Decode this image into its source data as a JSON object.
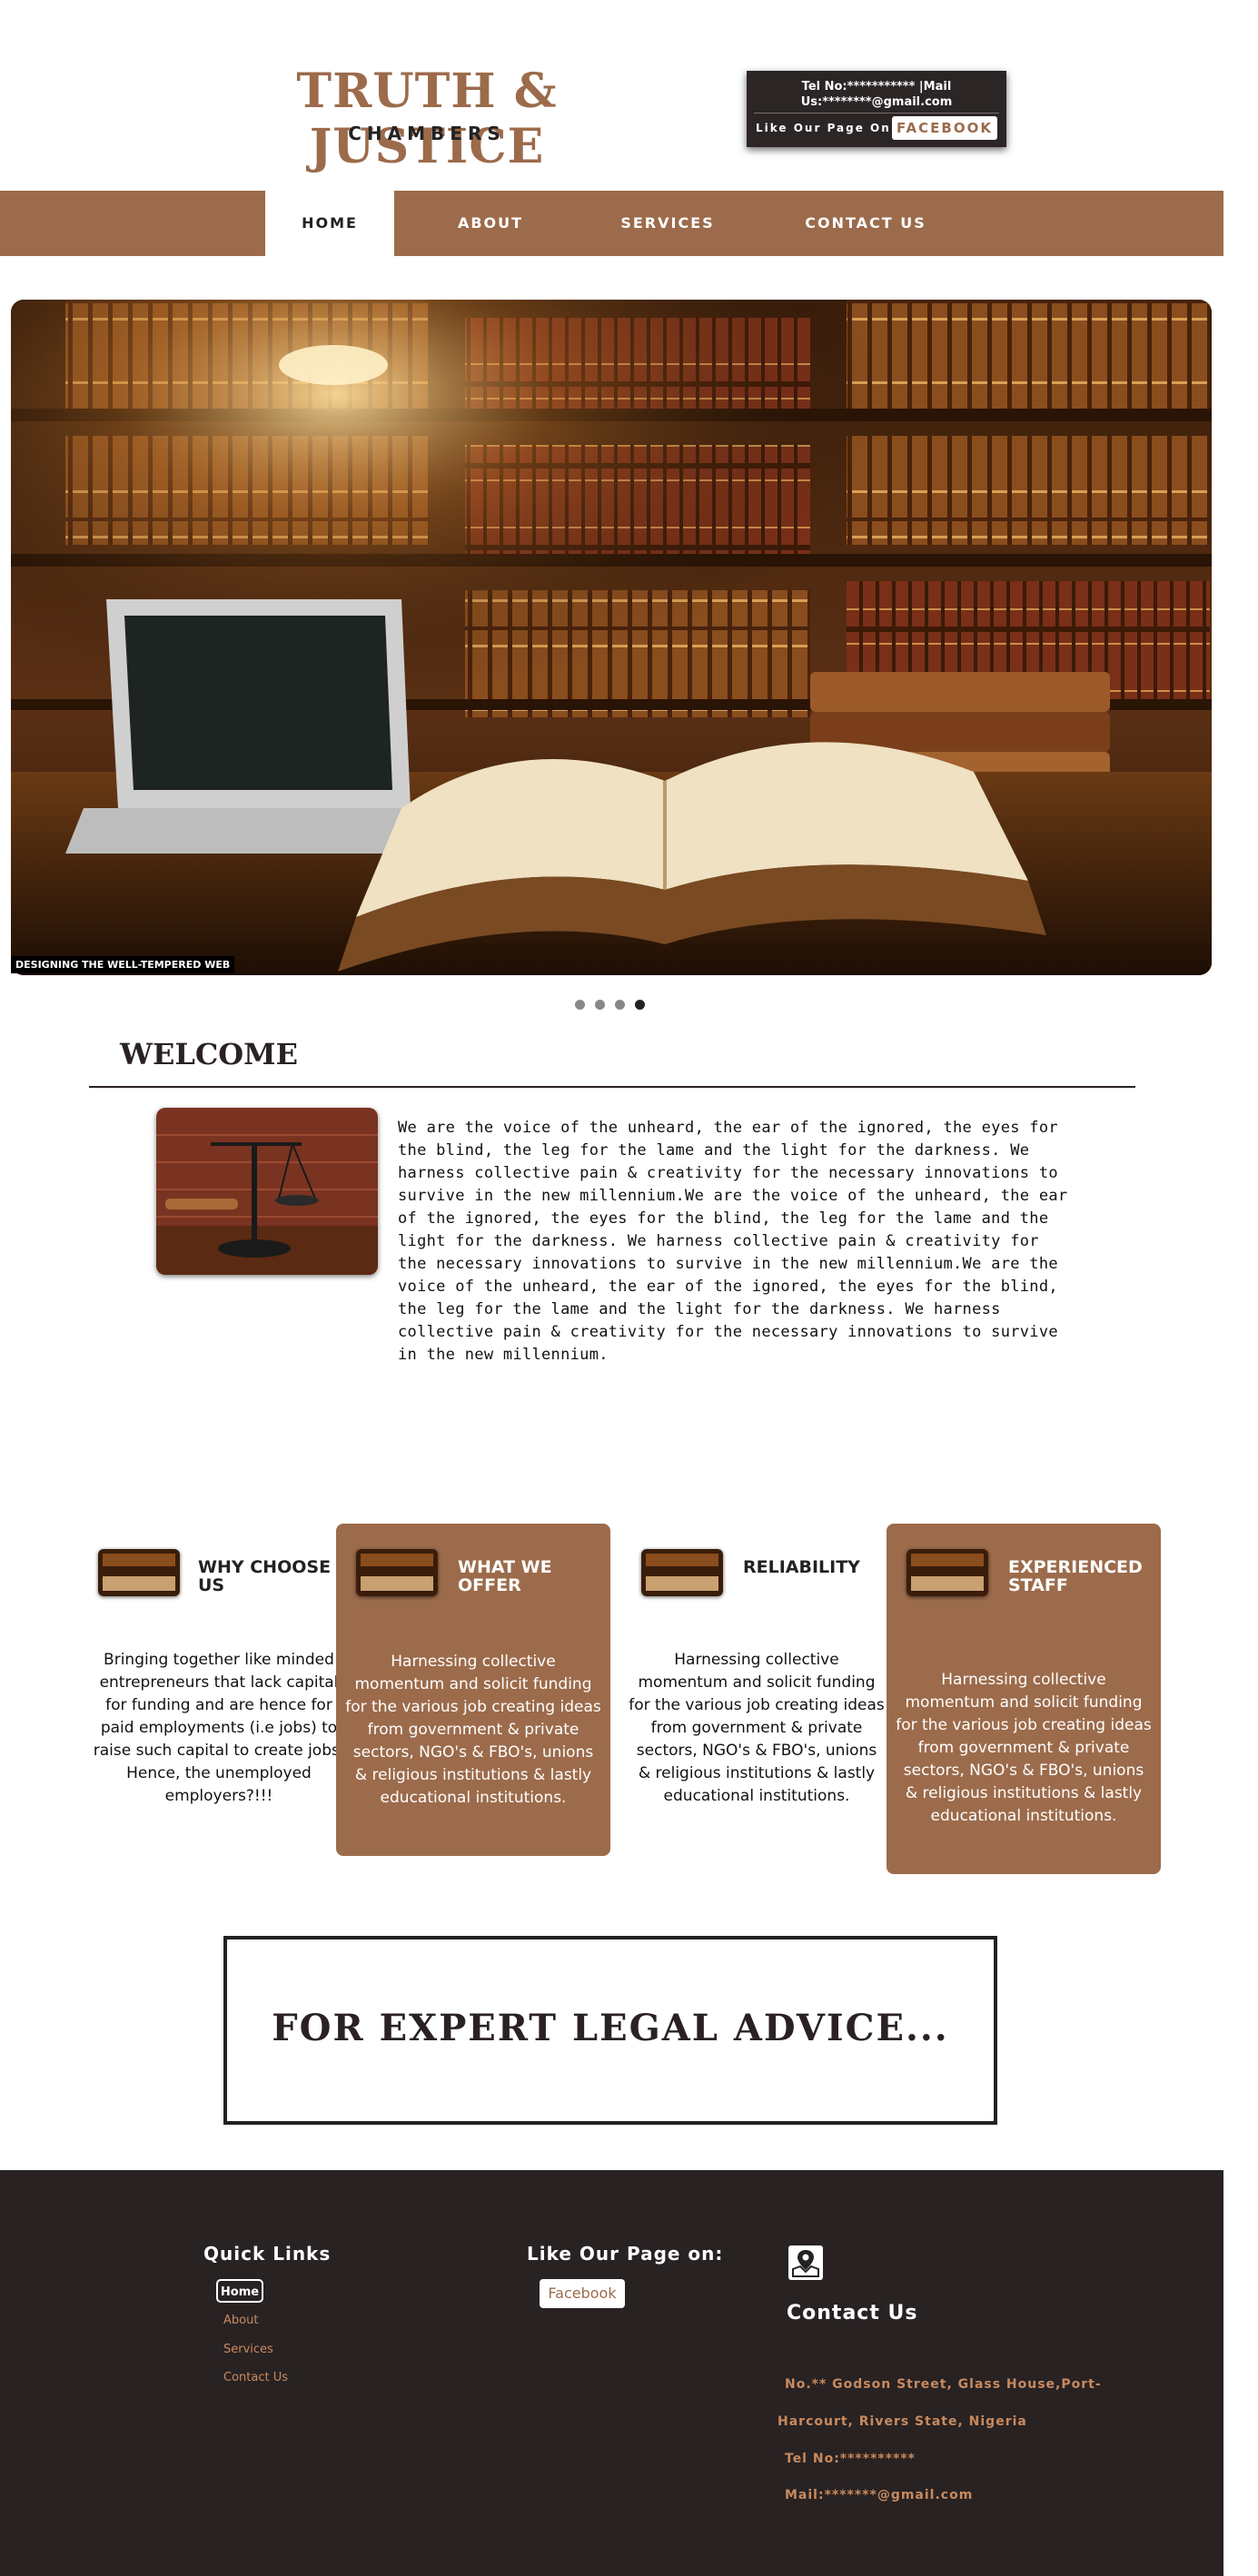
{
  "header": {
    "logo_title": "TRUTH & JUSTICE",
    "logo_subtitle": "CHAMBERS",
    "contact_tel": "Tel No:*********** |Mail",
    "contact_mail": "Us:********@gmail.com",
    "like_label": "Like Our Page On:",
    "facebook_label": "FACEBOOK"
  },
  "nav": {
    "items": [
      {
        "label": "HOME",
        "active": true
      },
      {
        "label": "ABOUT"
      },
      {
        "label": "SERVICES"
      },
      {
        "label": "CONTACT US"
      }
    ]
  },
  "slider": {
    "caption": "DESIGNING THE WELL-TEMPERED WEB",
    "slide_count": 4,
    "active_slide": 4
  },
  "welcome": {
    "title": "WELCOME",
    "text": "We are the voice of the unheard, the ear of the ignored, the eyes for the blind, the leg for the lame and the light for the darkness. We harness collective pain & creativity for the necessary innovations to survive in the new millennium.We are the voice of the unheard, the ear of the ignored, the eyes for the blind, the leg for the lame and the light for the darkness. We harness collective pain & creativity for the necessary innovations to survive in the new millennium.We are the voice of the unheard, the ear of the ignored, the eyes for the blind, the leg for the lame and the light for the darkness. We harness collective pain & creativity for the necessary innovations to survive in the new millennium."
  },
  "features": [
    {
      "title": "WHY CHOOSE US",
      "body": "Bringing together like minded entrepreneurs that lack capital for funding and are hence for paid employments (i.e jobs) to raise such capital to create jobs. Hence, the unemployed employers?!!!"
    },
    {
      "title": "WHAT WE OFFER",
      "body": "Harnessing collective momentum and solicit funding for the various job creating ideas from government & private sectors, NGO's & FBO's, unions & religious institutions & lastly educational institutions."
    },
    {
      "title": "RELIABILITY",
      "body": "Harnessing collective momentum and solicit funding for the various job creating ideas from government & private sectors, NGO's & FBO's, unions & religious institutions & lastly educational institutions."
    },
    {
      "title": "EXPERIENCED STAFF",
      "body": "Harnessing collective momentum and solicit funding for the various job creating ideas from government & private sectors, NGO's & FBO's, unions & religious institutions & lastly educational institutions."
    }
  ],
  "cta": {
    "text": "FOR EXPERT LEGAL ADVICE..."
  },
  "footer": {
    "quick_links_title": "Quick Links",
    "links": [
      "Home",
      "About",
      "Services",
      "Contact Us"
    ],
    "like_title": "Like Our Page on:",
    "facebook_label": "Facebook",
    "contact_title": "Contact Us",
    "address_line1": "No.** Godson Street, Glass  House,Port-",
    "address_line2": "Harcourt, Rivers   State, Nigeria",
    "tel": "Tel No:**********",
    "mail": "Mail:*******@gmail.com"
  },
  "colors": {
    "brand_brown": "#9c6b4b",
    "dark": "#282223",
    "link": "#c98a5d"
  }
}
